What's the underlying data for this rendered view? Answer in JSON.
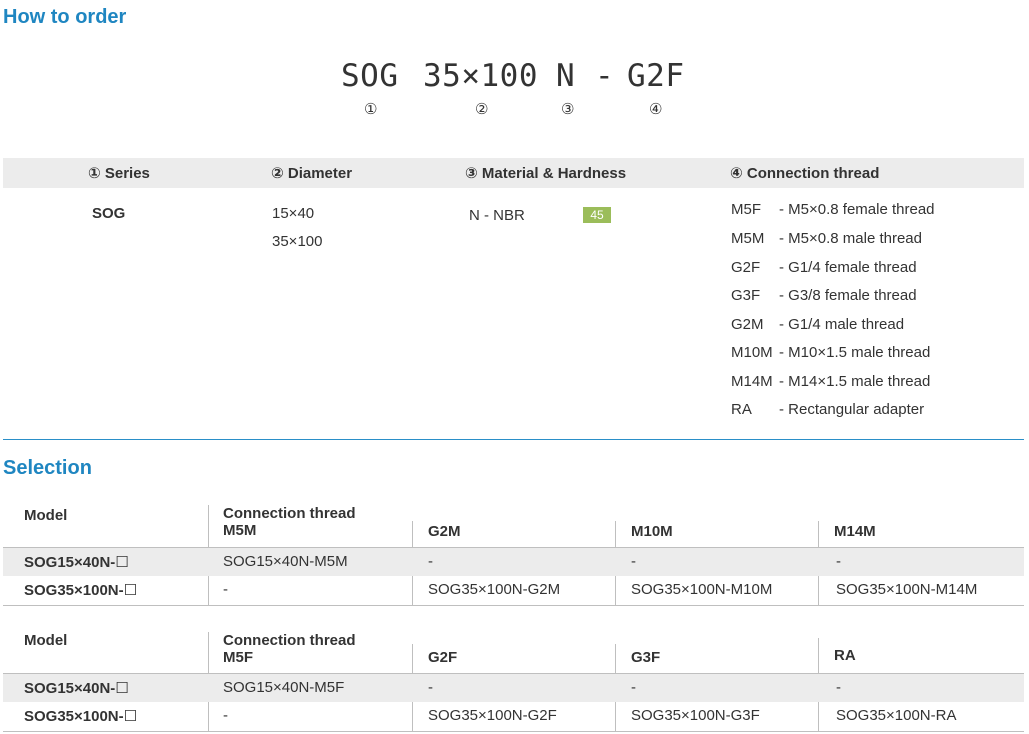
{
  "how_to_order": {
    "title": "How to order",
    "code_parts": [
      "SOG",
      "35×100",
      "N",
      "-",
      "G2F"
    ],
    "code_numbers": [
      "①",
      "②",
      "③",
      "④"
    ],
    "headers": [
      "① Series",
      "② Diameter",
      "③ Material & Hardness",
      "④ Connection thread"
    ],
    "series": "SOG",
    "diameters": [
      "15×40",
      "35×100"
    ],
    "material": "N - NBR",
    "hardness": "45",
    "hardness_color": "#9bbd5a",
    "threads": [
      {
        "code": "M5F",
        "desc": "- M5×0.8 female thread"
      },
      {
        "code": "M5M",
        "desc": "- M5×0.8 male thread"
      },
      {
        "code": "G2F",
        "desc": "- G1/4 female thread"
      },
      {
        "code": "G3F",
        "desc": "- G3/8 female thread"
      },
      {
        "code": "G2M",
        "desc": "- G1/4 male thread"
      },
      {
        "code": "M10M",
        "desc": "- M10×1.5 male thread"
      },
      {
        "code": "M14M",
        "desc": "- M14×1.5 male thread"
      },
      {
        "code": "RA",
        "desc": "- Rectangular adapter"
      }
    ]
  },
  "selection": {
    "title": "Selection",
    "tables": [
      {
        "model_label": "Model",
        "group_label": "Connection thread",
        "columns": [
          "M5M",
          "G2M",
          "M10M",
          "M14M"
        ],
        "rows": [
          {
            "model": "SOG15×40N-☐",
            "cells": [
              "SOG15×40N-M5M",
              "-",
              "-",
              "-"
            ]
          },
          {
            "model": "SOG35×100N-☐",
            "cells": [
              "-",
              "SOG35×100N-G2M",
              "SOG35×100N-M10M",
              "SOG35×100N-M14M"
            ]
          }
        ]
      },
      {
        "model_label": "Model",
        "group_label": "Connection thread",
        "columns": [
          "M5F",
          "G2F",
          "G3F",
          "RA"
        ],
        "rows": [
          {
            "model": "SOG15×40N-☐",
            "cells": [
              "SOG15×40N-M5F",
              "-",
              "-",
              "-"
            ]
          },
          {
            "model": "SOG35×100N-☐",
            "cells": [
              "-",
              "SOG35×100N-G2F",
              "SOG35×100N-G3F",
              "SOG35×100N-RA"
            ]
          }
        ]
      }
    ]
  },
  "colors": {
    "accent": "#1f86c1",
    "header_bg": "#ececec",
    "divider": "#2a8fc8"
  }
}
